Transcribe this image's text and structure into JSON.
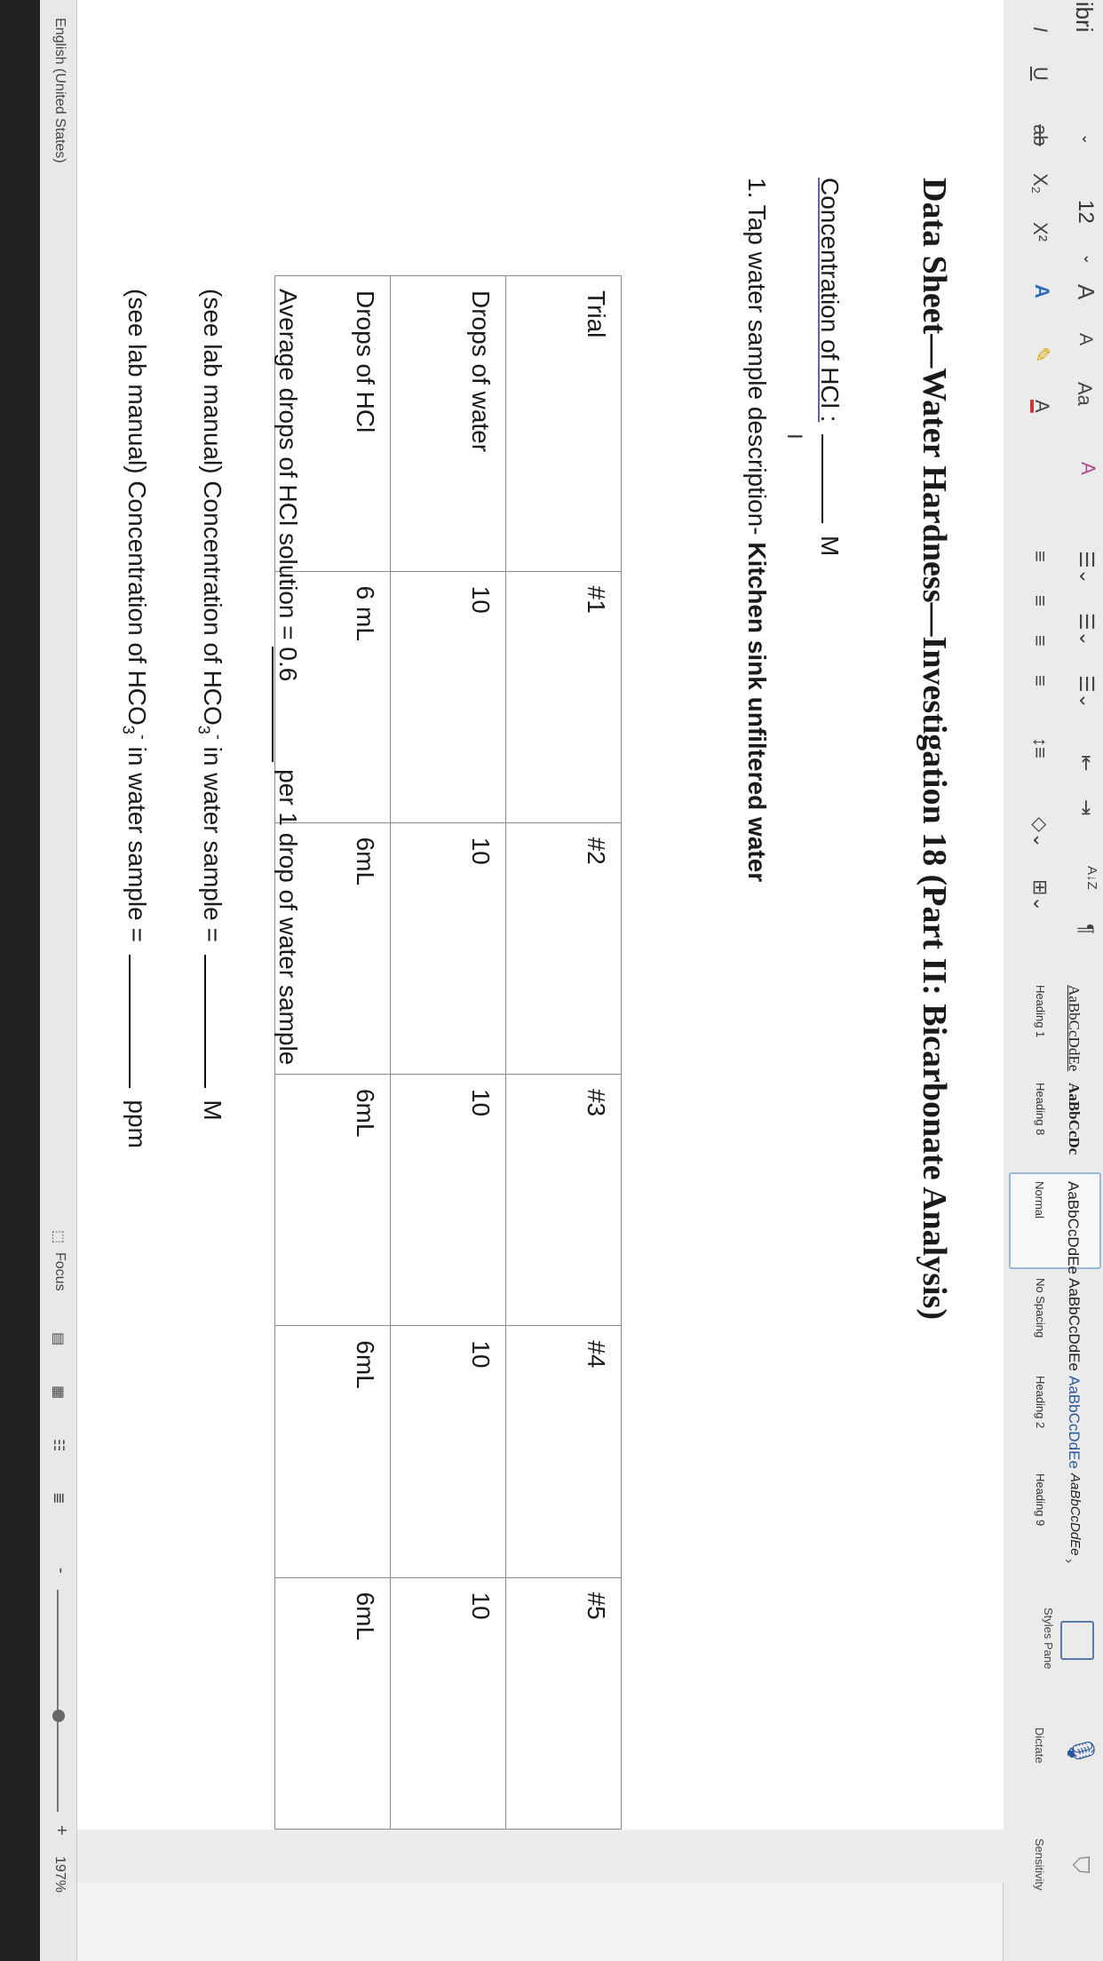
{
  "ribbon": {
    "font_name": "libri",
    "font_size": "12",
    "grow_font": "A",
    "shrink_font": "A",
    "change_case": "Aa",
    "bold_italic": "I",
    "underline": "U",
    "strikethrough": "ab",
    "subscript": "X₂",
    "superscript": "X²",
    "font_color": "A",
    "highlight": "A",
    "sort": "A↓Z",
    "pilcrow": "¶",
    "styles": [
      {
        "preview": "AaBbCcDdEe",
        "name": "Heading 1"
      },
      {
        "preview": "AaBbCcDc",
        "name": "Heading 8"
      },
      {
        "preview": "AaBbCcDdEe",
        "name": "Normal"
      },
      {
        "preview": "AaBbCcDdEe",
        "name": "No Spacing"
      },
      {
        "preview": "AaBbCcDdEe",
        "name": "Heading 2"
      },
      {
        "preview": "AaBbCcDdEe",
        "name": "Heading 9"
      }
    ],
    "styles_pane": "Styles Pane",
    "dictate": "Dictate",
    "sensitivity": "Sensitivity"
  },
  "document": {
    "title": "Data Sheet—Water Hardness—Investigation 18 (Part II: Bicarbonate Analysis)",
    "concentration_label": "Concentration of HCl :",
    "concentration_unit": "M",
    "cursor": "I",
    "sample_heading": "1. Tap water sample description-",
    "sample_description": "Kitchen sink unfiltered water",
    "table": {
      "rows": [
        [
          "Trial",
          "#1",
          "#2",
          "#3",
          "#4",
          "#5"
        ],
        [
          "Drops of water",
          "10",
          "10",
          "10",
          "10",
          "10"
        ],
        [
          "Drops of HCl",
          "6 mL",
          "6mL",
          "6mL",
          "6mL",
          "6mL"
        ]
      ]
    },
    "average_label": "Average drops of HCl solution =",
    "average_value": "0.6",
    "average_suffix": "per 1 drop of water sample",
    "hco3_conc_label": "(see lab manual) Concentration of HCO",
    "hco3_conc_suffix": " in water sample =",
    "hco3_conc_unit": "M",
    "hco3_ppm_label": "(see lab manual) Concentration of HCO",
    "hco3_ppm_suffix": " in water sample =",
    "hco3_ppm_unit": "ppm",
    "sub3": "3",
    "sup_minus": "-"
  },
  "status_bar": {
    "language": "English (United States)",
    "focus": "Focus",
    "zoom": "197%",
    "zoom_minus": "-",
    "zoom_plus": "+"
  },
  "colors": {
    "accent": "#2b579a",
    "highlight_underline": "#6b5fa8",
    "font_color_red": "#d13438"
  }
}
